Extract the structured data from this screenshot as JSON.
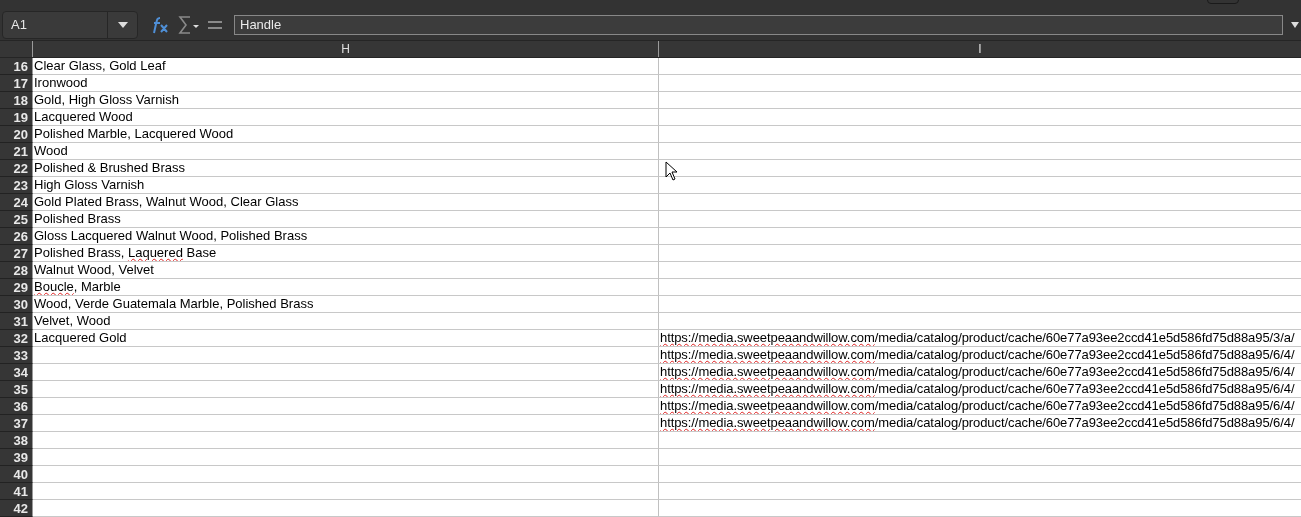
{
  "name_box": {
    "value": "A1"
  },
  "formula_bar": {
    "value": "Handle"
  },
  "columns": [
    "H",
    "I"
  ],
  "rows": [
    {
      "number": "16",
      "cells": [
        [
          {
            "text": "Clear Glass, Gold Leaf"
          }
        ],
        []
      ]
    },
    {
      "number": "17",
      "cells": [
        [
          {
            "text": "Ironwood"
          }
        ],
        []
      ]
    },
    {
      "number": "18",
      "cells": [
        [
          {
            "text": "Gold, High Gloss Varnish"
          }
        ],
        []
      ]
    },
    {
      "number": "19",
      "cells": [
        [
          {
            "text": "Lacquered Wood"
          }
        ],
        []
      ]
    },
    {
      "number": "20",
      "cells": [
        [
          {
            "text": "Polished Marble, Lacquered Wood"
          }
        ],
        []
      ]
    },
    {
      "number": "21",
      "cells": [
        [
          {
            "text": "Wood"
          }
        ],
        []
      ]
    },
    {
      "number": "22",
      "cells": [
        [
          {
            "text": "Polished & Brushed Brass"
          }
        ],
        []
      ]
    },
    {
      "number": "23",
      "cells": [
        [
          {
            "text": "High Gloss Varnish"
          }
        ],
        []
      ]
    },
    {
      "number": "24",
      "cells": [
        [
          {
            "text": "Gold Plated Brass, Walnut Wood, Clear Glass"
          }
        ],
        []
      ]
    },
    {
      "number": "25",
      "cells": [
        [
          {
            "text": "Polished Brass"
          }
        ],
        []
      ]
    },
    {
      "number": "26",
      "cells": [
        [
          {
            "text": "Gloss Lacquered Walnut Wood, Polished Brass"
          }
        ],
        []
      ]
    },
    {
      "number": "27",
      "cells": [
        [
          {
            "text": "Polished Brass, "
          },
          {
            "text": "Laquered",
            "misspelled": true
          },
          {
            "text": " Base"
          }
        ],
        []
      ]
    },
    {
      "number": "28",
      "cells": [
        [
          {
            "text": "Walnut Wood, Velvet"
          }
        ],
        []
      ]
    },
    {
      "number": "29",
      "cells": [
        [
          {
            "text": "Boucle",
            "misspelled": true
          },
          {
            "text": ", Marble"
          }
        ],
        []
      ]
    },
    {
      "number": "30",
      "cells": [
        [
          {
            "text": "Wood, Verde Guatemala Marble, Polished Brass"
          }
        ],
        []
      ]
    },
    {
      "number": "31",
      "cells": [
        [
          {
            "text": "Velvet, Wood"
          }
        ],
        []
      ]
    },
    {
      "number": "32",
      "cells": [
        [
          {
            "text": "Lacquered Gold"
          }
        ],
        [
          {
            "text": "https://media.sweetpeaandwillow.com",
            "misspelled": true
          },
          {
            "text": "/media/catalog/product/cache/60e77a93ee2ccd41e5d586fd75d88a95/3/a/"
          }
        ]
      ]
    },
    {
      "number": "33",
      "cells": [
        [],
        [
          {
            "text": "https://media.sweetpeaandwillow.com",
            "misspelled": true
          },
          {
            "text": "/media/catalog/product/cache/60e77a93ee2ccd41e5d586fd75d88a95/6/4/"
          }
        ]
      ]
    },
    {
      "number": "34",
      "cells": [
        [],
        [
          {
            "text": "https://media.sweetpeaandwillow.com",
            "misspelled": true
          },
          {
            "text": "/media/catalog/product/cache/60e77a93ee2ccd41e5d586fd75d88a95/6/4/"
          }
        ]
      ]
    },
    {
      "number": "35",
      "cells": [
        [],
        [
          {
            "text": "https://media.sweetpeaandwillow.com",
            "misspelled": true
          },
          {
            "text": "/media/catalog/product/cache/60e77a93ee2ccd41e5d586fd75d88a95/6/4/"
          }
        ]
      ]
    },
    {
      "number": "36",
      "cells": [
        [],
        [
          {
            "text": "https://media.sweetpeaandwillow.com",
            "misspelled": true
          },
          {
            "text": "/media/catalog/product/cache/60e77a93ee2ccd41e5d586fd75d88a95/6/4/"
          }
        ]
      ]
    },
    {
      "number": "37",
      "cells": [
        [],
        [
          {
            "text": "https://media.sweetpeaandwillow.com",
            "misspelled": true
          },
          {
            "text": "/media/catalog/product/cache/60e77a93ee2ccd41e5d586fd75d88a95/6/4/"
          }
        ]
      ]
    },
    {
      "number": "38",
      "cells": [
        [],
        []
      ]
    },
    {
      "number": "39",
      "cells": [
        [],
        []
      ]
    },
    {
      "number": "40",
      "cells": [
        [],
        []
      ]
    },
    {
      "number": "41",
      "cells": [
        [],
        []
      ]
    },
    {
      "number": "42",
      "cells": [
        [],
        []
      ]
    }
  ]
}
